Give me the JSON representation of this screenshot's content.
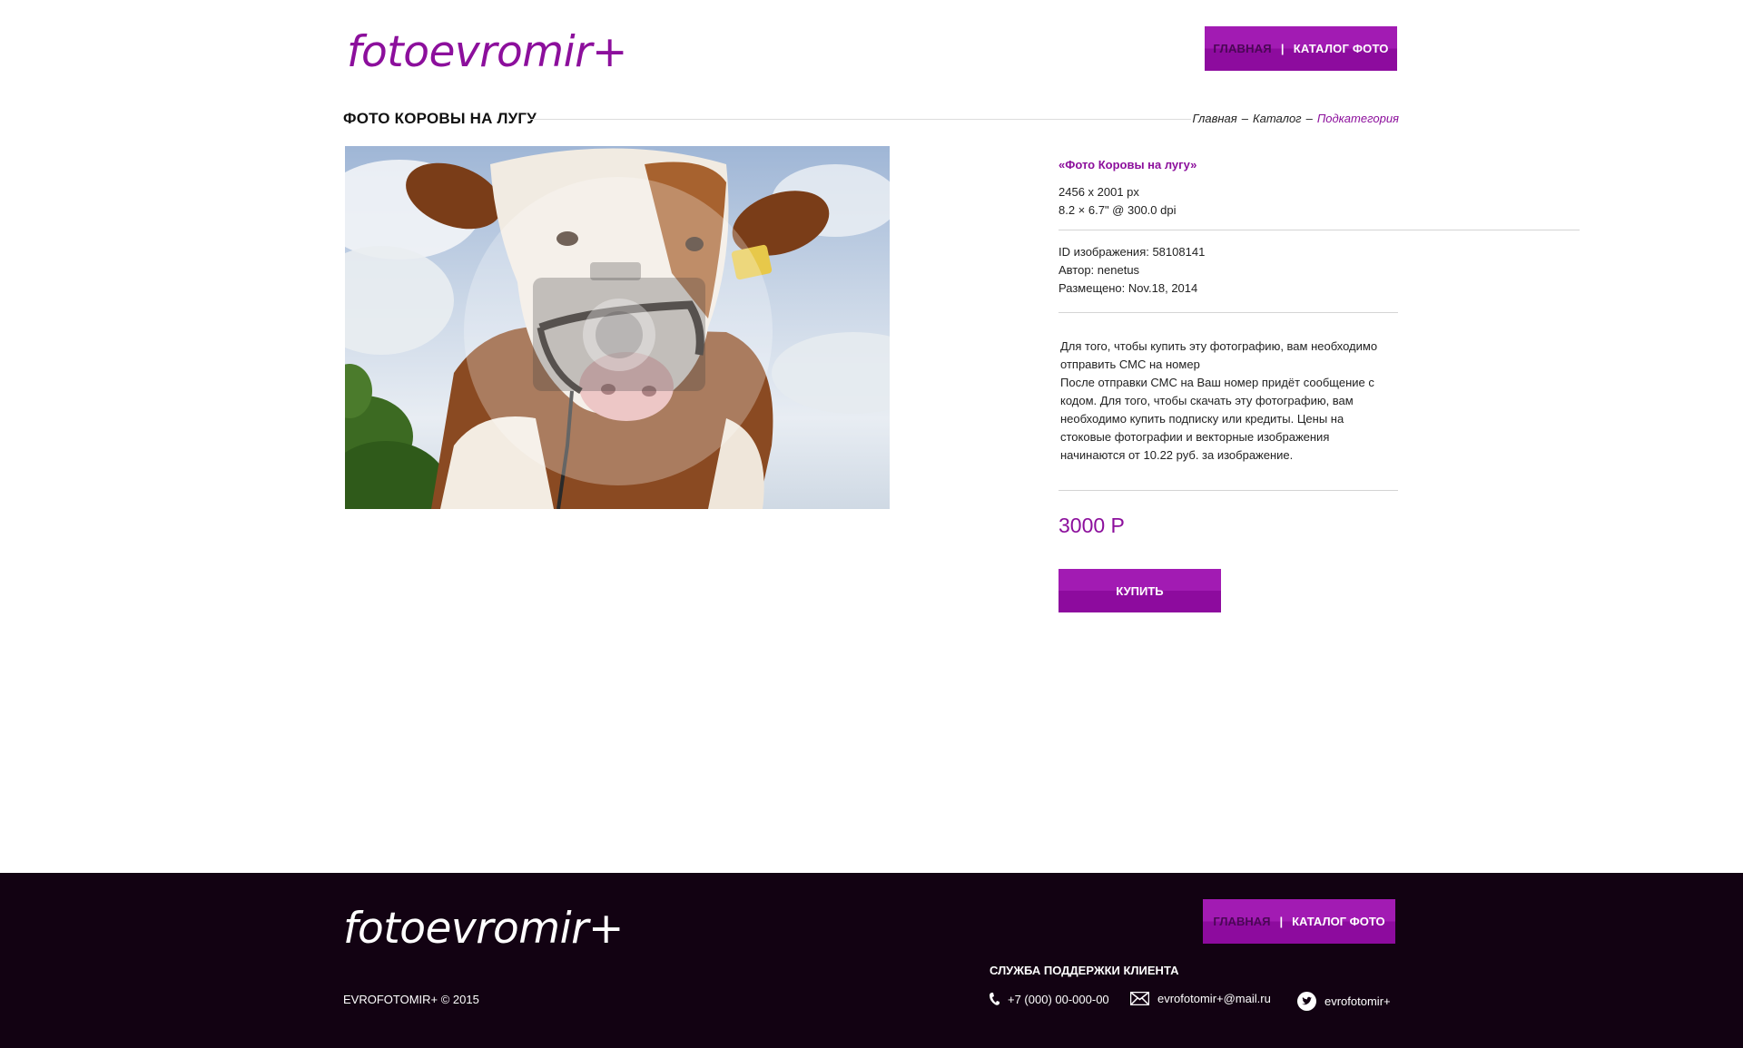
{
  "header": {
    "logo": "fotoevromir+",
    "nav": {
      "home": "ГЛАВНАЯ",
      "separator": "|",
      "catalog": "КАТАЛОГ ФОТО"
    }
  },
  "page": {
    "title": "ФОТО КОРОВЫ НА ЛУГУ",
    "breadcrumb": {
      "home": "Главная",
      "dash": "–",
      "catalog": "Каталог",
      "current": "Подкатегория"
    }
  },
  "photo": {
    "subject": "cow",
    "watermark_icon": "camera-icon"
  },
  "info": {
    "title": "«Фото Коровы на лугу»",
    "size_px": "2456 x 2001 px",
    "size_print": "8.2 × 6.7\" @ 300.0 dpi",
    "image_id": "ID изображения: 58108141",
    "author": "Автор: nenetus",
    "posted": "Размещено: Nov.18, 2014"
  },
  "description": {
    "line1": "Для того, чтобы купить эту фотографию, вам необходимо отправить СМС на номер",
    "line2": "После отправки СМС на Ваш номер придёт сообщение с кодом.  Для того, чтобы скачать эту фотографию, вам необходимо купить подписку или кредиты. Цены на стоковые фотографии и векторные изображения начинаются от 10.22 руб. за изображение."
  },
  "purchase": {
    "price": "3000 Р",
    "buy_label": "КУПИТЬ"
  },
  "footer": {
    "logo": "fotoevromir+",
    "nav": {
      "home": "ГЛАВНАЯ",
      "separator": "|",
      "catalog": "КАТАЛОГ ФОТО"
    },
    "copyright": "EVROFOTOMIR+ © 2015",
    "support_title": "СЛУЖБА ПОДДЕРЖКИ КЛИЕНТА",
    "phone": "+7 (000) 00-000-00",
    "email": "evrofotomir+@mail.ru",
    "twitter": "evrofotomir+"
  },
  "colors": {
    "accent": "#8c0f9c",
    "button": "#a21bb3",
    "footer_bg": "#120212"
  }
}
